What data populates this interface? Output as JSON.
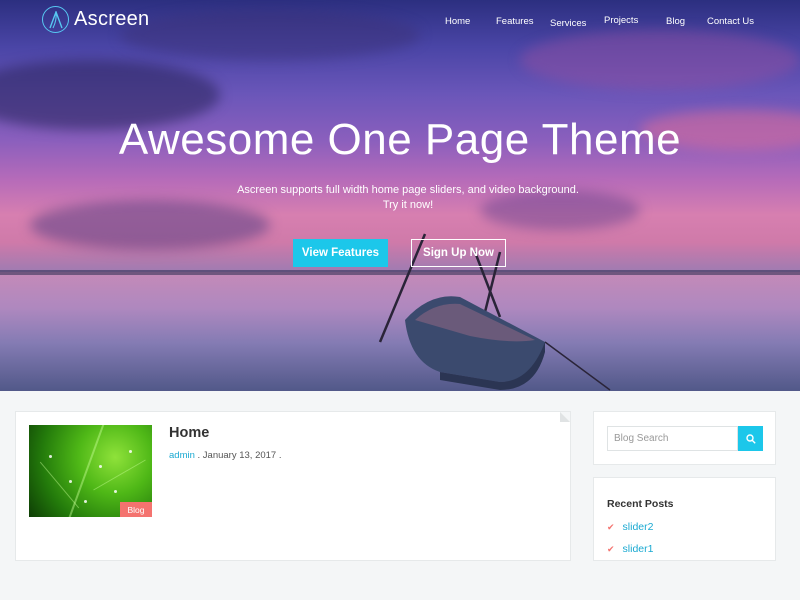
{
  "brand": {
    "name": "Ascreen",
    "logo_letter": "A",
    "accent": "#1cc7ea",
    "logo_ring": "#57c8f2"
  },
  "nav": {
    "items": [
      {
        "label": "Home"
      },
      {
        "label": "Features"
      },
      {
        "label": "Services"
      },
      {
        "label": "Projects"
      },
      {
        "label": "Blog"
      },
      {
        "label": "Contact Us"
      }
    ]
  },
  "hero": {
    "title": "Awesome One Page Theme",
    "subtitle_line1": "Ascreen supports full width home page sliders, and video background.",
    "subtitle_line2": "Try it now!",
    "primary_button": "View Features",
    "secondary_button": "Sign Up Now"
  },
  "post": {
    "title": "Home",
    "author": "admin",
    "separator": " . ",
    "date": "January 13, 2017",
    "trailing": " .",
    "category_badge": "Blog",
    "badge_color": "#f4736f"
  },
  "sidebar": {
    "search": {
      "placeholder": "Blog Search",
      "icon": "search-icon"
    },
    "recent_posts": {
      "title": "Recent Posts",
      "items": [
        {
          "label": "slider2",
          "icon": "check-icon"
        },
        {
          "label": "slider1",
          "icon": "check-icon"
        }
      ]
    }
  }
}
